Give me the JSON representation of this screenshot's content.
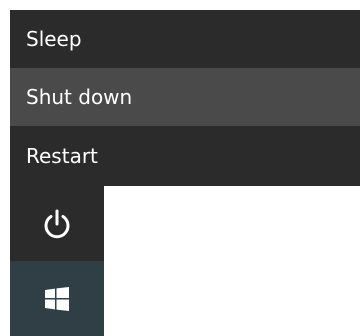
{
  "menu": {
    "items": [
      {
        "label": "Sleep"
      },
      {
        "label": "Shut down"
      },
      {
        "label": "Restart"
      }
    ],
    "hovered_item": "Shut down"
  },
  "rail": {
    "power_icon": "power-icon",
    "start_icon": "windows-logo-icon"
  },
  "colors": {
    "menu_bg": "#2b2b2b",
    "menu_hover_bg": "#4a4a4a",
    "text": "#ffffff",
    "start_button_bg": "#2f3f45",
    "page_bg": "#ffffff"
  }
}
